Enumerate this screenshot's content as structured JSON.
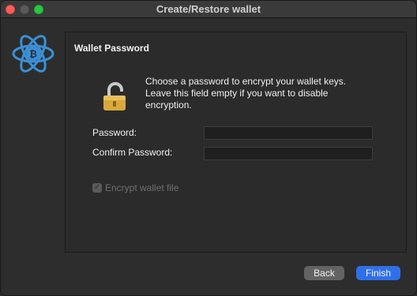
{
  "window": {
    "title": "Create/Restore wallet"
  },
  "panel": {
    "title": "Wallet Password",
    "description_lines": [
      "Choose a password to encrypt your wallet keys.",
      "Leave this field empty if you want to disable",
      "encryption."
    ]
  },
  "form": {
    "password_label": "Password:",
    "password_value": "",
    "confirm_label": "Confirm Password:",
    "confirm_value": "",
    "encrypt_label": "Encrypt wallet file",
    "encrypt_checked": true,
    "encrypt_enabled": false
  },
  "buttons": {
    "back_label": "Back",
    "finish_label": "Finish"
  },
  "colors": {
    "logo": "#3b8fd6",
    "accent": "#2f70ea",
    "close": "#fe5f57",
    "zoom": "#28c840"
  }
}
